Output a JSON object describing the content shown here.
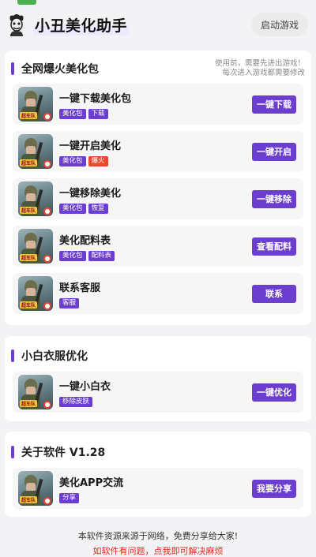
{
  "header": {
    "title": "小丑美化助手",
    "launch_label": "启动游戏",
    "logo_icon": "joker-icon"
  },
  "sections": [
    {
      "title": "全网爆火美化包",
      "note_line1": "使用前，需要先进出游戏！",
      "note_line2": "每次进入游戏都需要修改",
      "items": [
        {
          "title": "一键下载美化包",
          "badges": [
            "美化包",
            "下载"
          ],
          "button": "一键下载"
        },
        {
          "title": "一键开启美化",
          "badges": [
            "美化包",
            "爆火"
          ],
          "button": "一键开启"
        },
        {
          "title": "一键移除美化",
          "badges": [
            "美化包",
            "恢复"
          ],
          "button": "一键移除"
        },
        {
          "title": "美化配料表",
          "badges": [
            "美化包",
            "配料表"
          ],
          "button": "查看配料"
        },
        {
          "title": "联系客服",
          "badges": [
            "客服"
          ],
          "button": "联系"
        }
      ]
    },
    {
      "title": "小白衣服优化",
      "items": [
        {
          "title": "一键小白衣",
          "badges": [
            "移除皮肤"
          ],
          "button": "一键优化"
        }
      ]
    },
    {
      "title": "关于软件 V1.28",
      "items": [
        {
          "title": "美化APP交流",
          "badges": [
            "分享"
          ],
          "button": "我要分享"
        }
      ]
    }
  ],
  "thumb_tag": "超车队",
  "footer": {
    "line1": "本软件资源来源于网络，免费分享给大家!",
    "line2": "如软件有问题，点我即可解决麻烦"
  },
  "colors": {
    "accent": "#6c3ed0",
    "badge_red": "#e64a2e",
    "footer_red": "#e02b1c"
  }
}
